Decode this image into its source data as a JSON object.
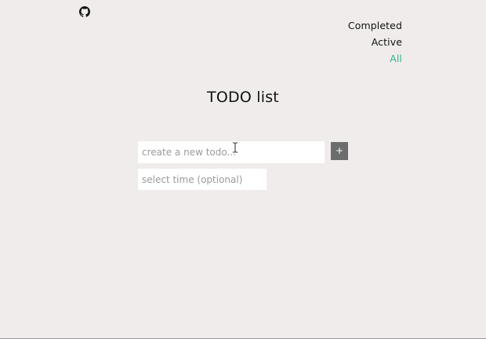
{
  "header": {
    "github_icon": "github-icon"
  },
  "filters": {
    "items": [
      {
        "label": "Completed",
        "selected": false
      },
      {
        "label": "Active",
        "selected": false
      },
      {
        "label": "All",
        "selected": true
      }
    ]
  },
  "main": {
    "title": "TODO list",
    "todo_input": {
      "value": "",
      "placeholder": "create a new todo..."
    },
    "add_button_label": "+",
    "time_input": {
      "value": "",
      "placeholder": "select time (optional)"
    }
  },
  "colors": {
    "background": "#f0ecec",
    "accent": "#2fb48f",
    "button": "#6d6d6d"
  }
}
